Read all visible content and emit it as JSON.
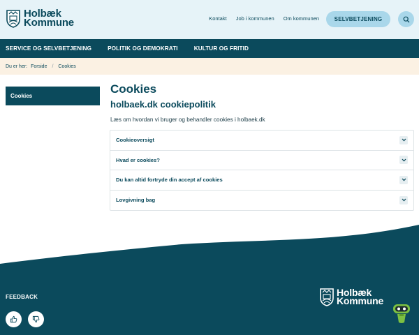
{
  "header": {
    "logo_line1": "Holbæk",
    "logo_line2": "Kommune",
    "links": [
      "Kontakt",
      "Job i kommunen",
      "Om kommunen"
    ],
    "self_service_button": "SELVBETJENING",
    "search_icon": "search-icon"
  },
  "nav": {
    "items": [
      "SERVICE OG SELVBETJENING",
      "POLITIK OG DEMOKRATI",
      "KULTUR OG FRITID"
    ]
  },
  "breadcrumb": {
    "prefix": "Du er her:",
    "items": [
      "Forside",
      "Cookies"
    ],
    "separator": "/"
  },
  "sidebar": {
    "active_item": "Cookies"
  },
  "main": {
    "title": "Cookies",
    "subtitle": "holbaek.dk cookiepolitik",
    "lead": "Læs om hvordan vi bruger og behandler cookies i holbaek.dk",
    "accordion": [
      "Cookieoversigt",
      "Hvad er cookies?",
      "Du kan altid fortryde din accept af cookies",
      "Lovgivning bag"
    ]
  },
  "footer": {
    "feedback_label": "FEEDBACK",
    "thumbs_up_icon": "thumbs-up-icon",
    "thumbs_down_icon": "thumbs-down-icon",
    "logo_line1": "Holbæk",
    "logo_line2": "Kommune",
    "chatbot_icon": "chatbot-icon"
  },
  "colors": {
    "primary": "#0b4a5c",
    "header_bg": "#e6f3f8",
    "button_bg": "#a9d7ea",
    "breadcrumb_bg": "#fbf1e3"
  }
}
